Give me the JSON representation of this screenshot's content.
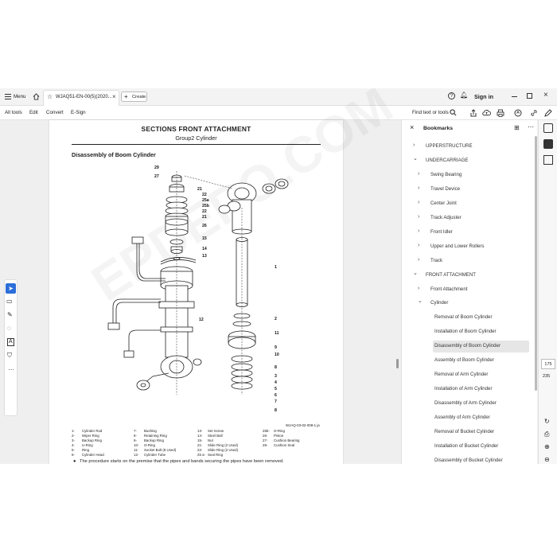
{
  "tabbar": {
    "menu_label": "Menu",
    "tab_title": "WJAQ51-EN-00(5)(2020...",
    "create_label": "Create",
    "signin_label": "Sign in"
  },
  "toolbar": {
    "items": [
      "All tools",
      "Edit",
      "Convert",
      "E-Sign"
    ],
    "find_label": "Find text or tools"
  },
  "document": {
    "section_title": "SECTIONS FRONT ATTACHMENT",
    "group_title": "Group2 Cylinder",
    "heading": "Disassembly of Boom Cylinder",
    "watermark": "EPDEPO.COM",
    "figure_code": "WJAQ-03-02-008-1 ja",
    "callouts": [
      "29",
      "27",
      "21",
      "22",
      "25a",
      "25b",
      "22",
      "21",
      "26",
      "15",
      "14",
      "13",
      "12",
      "1",
      "2",
      "11",
      "9",
      "10",
      "8",
      "3",
      "4",
      "5",
      "6",
      "7",
      "8"
    ],
    "legend": [
      [
        "1-",
        "Cylinder Rod",
        "7-",
        "Bushing",
        "13-",
        "Set Screw",
        "25b-",
        "O-Ring"
      ],
      [
        "2-",
        "Wiper Ring",
        "8-",
        "Retaining Ring",
        "14-",
        "Steel Ball",
        "26-",
        "Piston"
      ],
      [
        "3-",
        "Backup Ring",
        "9-",
        "Backup Ring",
        "15-",
        "Nut",
        "27-",
        "Cushion Bearing"
      ],
      [
        "4-",
        "U-Ring",
        "10-",
        "O-Ring",
        "21-",
        "Slide Ring (2 Used)",
        "28-",
        "Cushion Seal"
      ],
      [
        "5-",
        "Ring",
        "11-",
        "Socket Bolt (8 Used)",
        "22-",
        "Slide Ring (2 Used)",
        "",
        ""
      ],
      [
        "6-",
        "Cylinder Head",
        "12-",
        "Cylinder Tube",
        "25 a-",
        "Seal Ring",
        "",
        ""
      ]
    ],
    "note": "The procedure starts on the premise that the pipes and bands securing the pipes have been removed."
  },
  "bookmarks": {
    "title": "Bookmarks",
    "items": [
      {
        "label": "UPPERSTRUCTURE",
        "level": 0,
        "chevron": "right"
      },
      {
        "label": "UNDERCARRIAGE",
        "level": 0,
        "chevron": "down"
      },
      {
        "label": "Swing Bearing",
        "level": 1,
        "chevron": "right"
      },
      {
        "label": "Travel Device",
        "level": 1,
        "chevron": "right"
      },
      {
        "label": "Center Joint",
        "level": 1,
        "chevron": "right"
      },
      {
        "label": "Track Adjuster",
        "level": 1,
        "chevron": "right"
      },
      {
        "label": "Front Idler",
        "level": 1,
        "chevron": "right"
      },
      {
        "label": "Upper and Lower Rollers",
        "level": 1,
        "chevron": "right"
      },
      {
        "label": "Track",
        "level": 1,
        "chevron": "right"
      },
      {
        "label": "FRONT ATTACHMENT",
        "level": 0,
        "chevron": "down"
      },
      {
        "label": "Front Attachment",
        "level": 1,
        "chevron": "right"
      },
      {
        "label": "Cylinder",
        "level": 1,
        "chevron": "down"
      },
      {
        "label": "Removal of Boom Cylinder",
        "level": 2,
        "chevron": ""
      },
      {
        "label": "Installation of Boom Cylinder",
        "level": 2,
        "chevron": ""
      },
      {
        "label": "Disassembly of Boom Cylinder",
        "level": 2,
        "chevron": "",
        "selected": true
      },
      {
        "label": "Assembly of Boom Cylinder",
        "level": 2,
        "chevron": ""
      },
      {
        "label": "Removal of Arm Cylinder",
        "level": 2,
        "chevron": ""
      },
      {
        "label": "Installation of Arm Cylinder",
        "level": 2,
        "chevron": ""
      },
      {
        "label": "Disassembly of Arm Cylinder",
        "level": 2,
        "chevron": ""
      },
      {
        "label": "Assembly of Arm Cylinder",
        "level": 2,
        "chevron": ""
      },
      {
        "label": "Removal of Bucket Cylinder",
        "level": 2,
        "chevron": ""
      },
      {
        "label": "Installation of Bucket Cylinder",
        "level": 2,
        "chevron": ""
      },
      {
        "label": "Disassembly of Bucket Cylinder",
        "level": 2,
        "chevron": ""
      }
    ]
  },
  "page_nav": {
    "current_page": "175",
    "total_pages": "235"
  }
}
